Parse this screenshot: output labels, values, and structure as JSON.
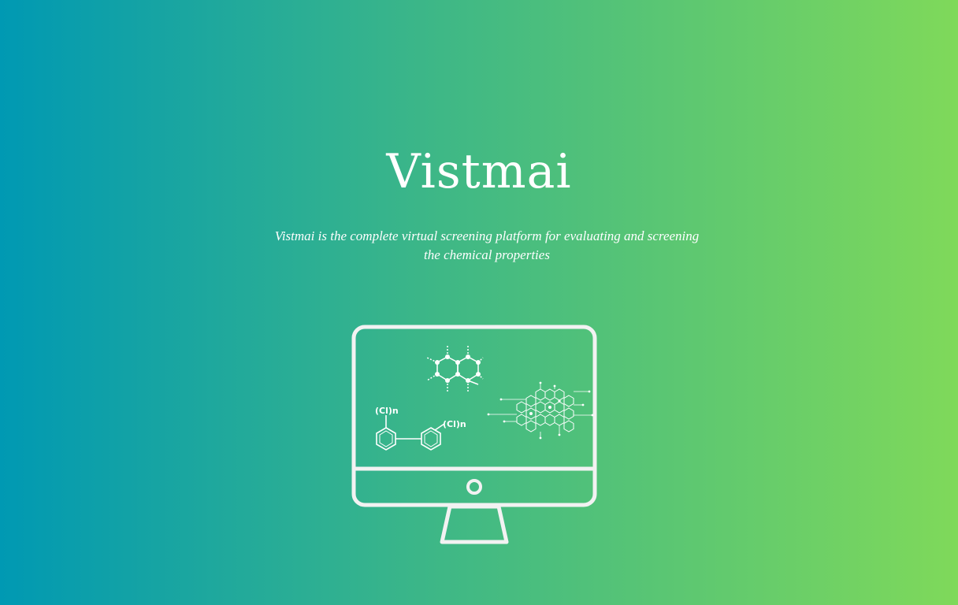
{
  "hero": {
    "title": "Vistmai",
    "subtitle": "Vistmai is the complete virtual screening platform for evaluating and screening the chemical properties"
  },
  "illustration": {
    "formula_label_1": "(Cl)n",
    "formula_label_2": "(Cl)n",
    "icon": "computer-monitor-molecules-icon"
  },
  "colors": {
    "gradient_start": "#0099b3",
    "gradient_mid": "#3db787",
    "gradient_end": "#7fd95a",
    "foreground": "#ffffff"
  }
}
